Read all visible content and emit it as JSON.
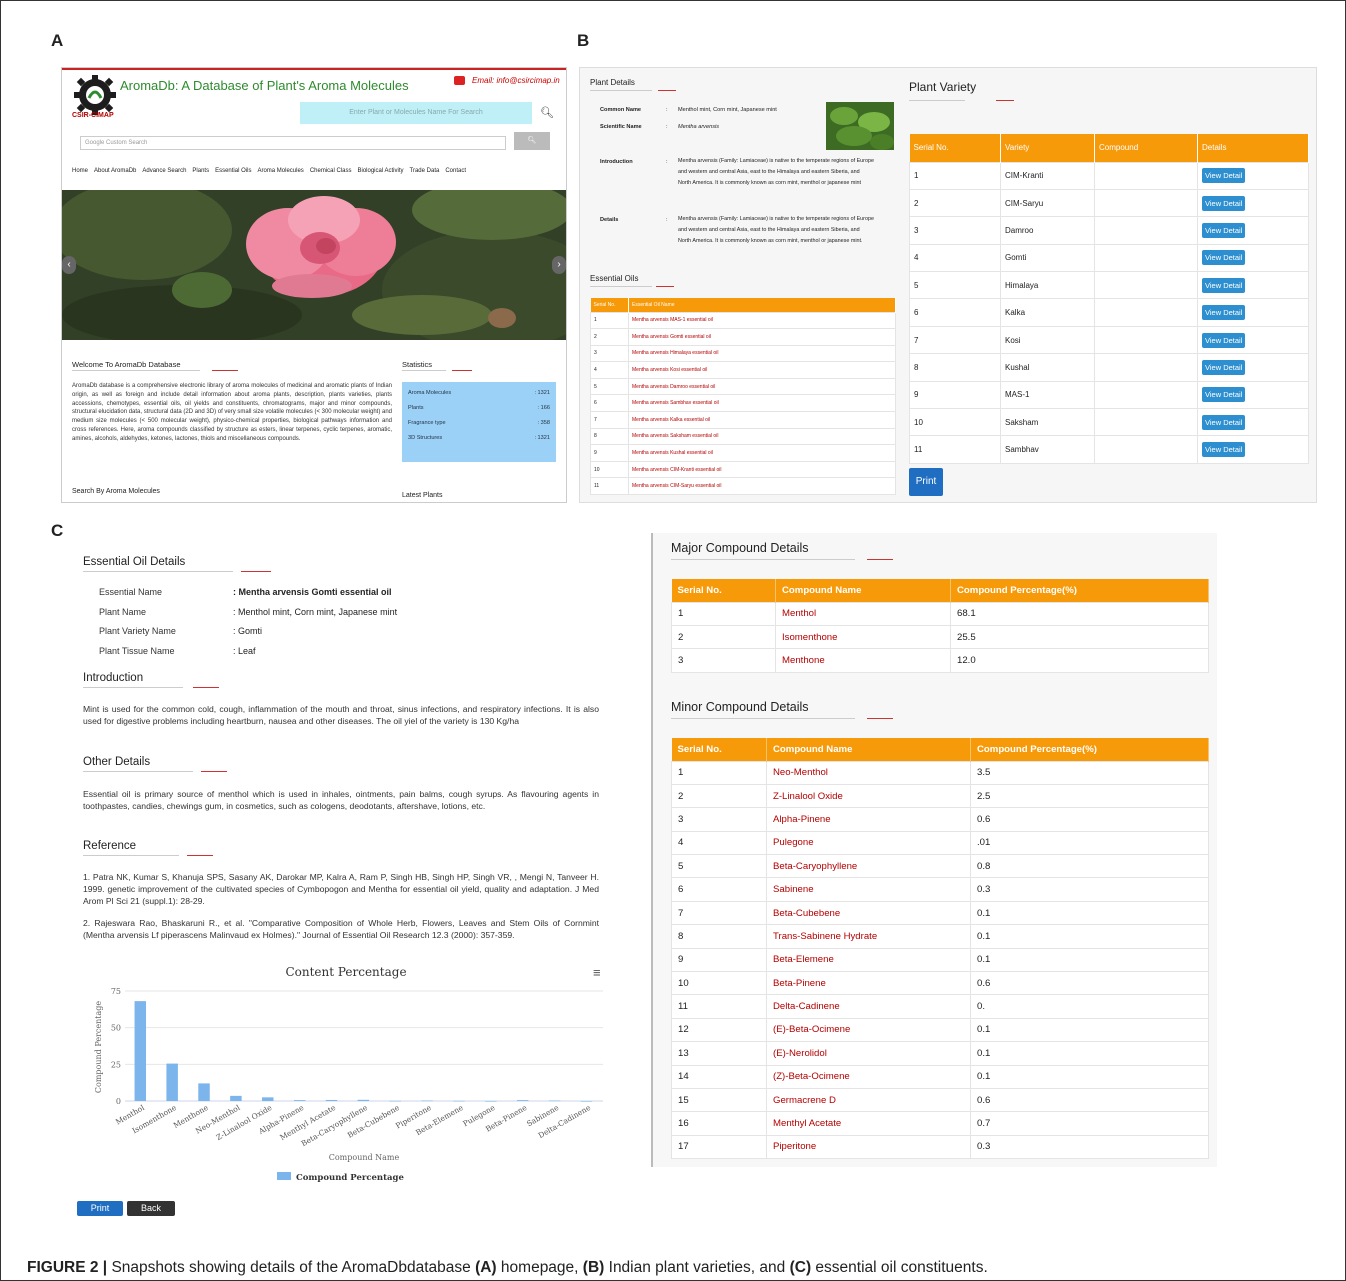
{
  "panel_labels": {
    "a": "A",
    "b": "B",
    "c": "C"
  },
  "homepage": {
    "logo_text": "CSIR-CIMAP",
    "title": "AromaDb: A Database of Plant's Aroma Molecules",
    "email": "Email: info@csircimap.in",
    "search_placeholder": "Enter Plant or Molecules Name For Search",
    "custom_search_placeholder": "Google Custom Search",
    "nav": [
      "Home",
      "About AromaDb",
      "Advance Search",
      "Plants",
      "Essential Oils",
      "Aroma Molecules",
      "Chemical Class",
      "Biological Activity",
      "Trade Data",
      "Contact"
    ],
    "welcome_title": "Welcome To AromaDb Database",
    "welcome_body": "AromaDb database is a comprehensive electronic library of aroma molecules of medicinal and aromatic plants of Indian origin, as well as foreign and include detail information about aroma plants, description, plants varieties, plants accessions, chemotypes, essential oils, oil yields and constituents, chromatograms, major and minor compounds, structural elucidation data, structural data (2D and 3D) of very small size volatile molecules (< 300 molecular weight) and medium size molecules (< 500 molecular weight), physico-chemical properties, biological pathways information and cross references. Here, aroma compounds classified by structure as esters, linear terpenes, cyclic terpenes, aromatic, amines, alcohols, aldehydes, ketones, lactones, thiols and miscellaneous compounds.",
    "statistics_title": "Statistics",
    "stats": [
      {
        "label": "Aroma Molecules",
        "value": ": 1321"
      },
      {
        "label": "Plants",
        "value": ": 166"
      },
      {
        "label": "Fragrance type",
        "value": ": 358"
      },
      {
        "label": "3D Structures",
        "value": ": 1321"
      }
    ],
    "search_by": "Search By Aroma Molecules",
    "latest_plants": "Latest Plants"
  },
  "plant": {
    "details_title": "Plant Details",
    "common_name_label": "Common Name",
    "common_name": "Menthol mint, Corn mint, Japanese mint",
    "scientific_name_label": "Scientific Name",
    "scientific_name": "Mentha arvensis",
    "colon": ":",
    "intro_label": "Introduction",
    "intro": "Mentha arvensis (Family: Lamiaceae) is native to the temperate regions of Europe and western and central Asia, east to the Himalaya and eastern Siberia, and North America. It is commonly known as corn mint, menthol or japanese mint",
    "details_label": "Details",
    "details": "Mentha arvensis (Family: Lamiaceae) is native to the temperate regions of Europe and western and central Asia, east to the Himalaya and eastern Siberia, and North America. It is commonly known as corn mint, menthol or japanese mint.",
    "eo_title": "Essential Oils",
    "eo_headers": [
      "Serial No.",
      "Essential Oil Name"
    ],
    "eo_rows": [
      [
        "1",
        "Mentha arvensis MAS-1 essential oil"
      ],
      [
        "2",
        "Mentha arvensis Gomti essential oil"
      ],
      [
        "3",
        "Mentha arvensis Himalaya essential oil"
      ],
      [
        "4",
        "Mentha arvensis Kosi essential oil"
      ],
      [
        "5",
        "Mentha arvensis Damroo essential oil"
      ],
      [
        "6",
        "Mentha arvensis Sambhav essential oil"
      ],
      [
        "7",
        "Mentha arvensis Kalka essential oil"
      ],
      [
        "8",
        "Mentha arvensis Saksham essential oil"
      ],
      [
        "9",
        "Mentha arvensis Kushal essential oil"
      ],
      [
        "10",
        "Mentha arvensis CIM-Kranti essential oil"
      ],
      [
        "11",
        "Mentha arvensis CIM-Saryu essential oil"
      ]
    ],
    "variety_title": "Plant Variety",
    "variety_headers": [
      "Serial No.",
      "Variety",
      "Compound",
      "Details"
    ],
    "view_detail": "View Detail",
    "varieties": [
      [
        "1",
        "CIM-Kranti",
        ""
      ],
      [
        "2",
        "CIM-Saryu",
        ""
      ],
      [
        "3",
        "Damroo",
        ""
      ],
      [
        "4",
        "Gomti",
        ""
      ],
      [
        "5",
        "Himalaya",
        ""
      ],
      [
        "6",
        "Kalka",
        ""
      ],
      [
        "7",
        "Kosi",
        ""
      ],
      [
        "8",
        "Kushal",
        ""
      ],
      [
        "9",
        "MAS-1",
        ""
      ],
      [
        "10",
        "Saksham",
        ""
      ],
      [
        "11",
        "Sambhav",
        ""
      ]
    ],
    "print": "Print"
  },
  "oil": {
    "title": "Essential Oil Details",
    "fields": [
      {
        "label": "Essential Name",
        "value": ": Mentha arvensis Gomti essential oil"
      },
      {
        "label": "Plant Name",
        "value": ": Menthol mint, Corn mint, Japanese mint"
      },
      {
        "label": "Plant Variety Name",
        "value": ": Gomti"
      },
      {
        "label": "Plant Tissue Name",
        "value": ": Leaf"
      }
    ],
    "intro_title": "Introduction",
    "intro": "Mint is used for the common cold, cough, inflammation of the mouth and throat, sinus infections, and respiratory infections. It is also used for digestive problems including heartburn, nausea and other diseases. The oil yiel of the variety is 130 Kg/ha",
    "other_title": "Other Details",
    "other": "Essential oil is primary source of menthol which is used in inhales, ointments, pain balms, cough syrups. As flavouring agents in toothpastes, candies, chewings gum, in cosmetics, such as cologens, deodotants, aftershave, lotions, etc.",
    "ref_title": "Reference",
    "ref1": "1. Patra NK, Kumar S, Khanuja SPS, Sasany AK, Darokar MP, Kalra A, Ram P, Singh HB, Singh HP, Singh VR, , Mengi N, Tanveer H. 1999. genetic improvement of the cultivated species of Cymbopogon and Mentha for essential oil yield, quality and adaptation. J Med Arom Pl Sci 21 (suppl.1): 28-29.",
    "ref2": "2. Rajeswara Rao, Bhaskaruni R., et al. \"Comparative Composition of Whole Herb, Flowers, Leaves and Stem Oils of Cornmint (Mentha arvensis Lf piperascens Malinvaud ex Holmes).\" Journal of Essential Oil Research 12.3 (2000): 357-359.",
    "print": "Print",
    "back": "Back",
    "major_title": "Major Compound Details",
    "minor_title": "Minor Compound Details",
    "table_headers": [
      "Serial No.",
      "Compound Name",
      "Compound Percentage(%)"
    ],
    "major": [
      [
        "1",
        "Menthol",
        "68.1"
      ],
      [
        "2",
        "Isomenthone",
        "25.5"
      ],
      [
        "3",
        "Menthone",
        "12.0"
      ]
    ],
    "minor": [
      [
        "1",
        "Neo-Menthol",
        "3.5"
      ],
      [
        "2",
        "Z-Linalool Oxide",
        "2.5"
      ],
      [
        "3",
        "Alpha-Pinene",
        "0.6"
      ],
      [
        "4",
        "Pulegone",
        ".01"
      ],
      [
        "5",
        "Beta-Caryophyllene",
        "0.8"
      ],
      [
        "6",
        "Sabinene",
        "0.3"
      ],
      [
        "7",
        "Beta-Cubebene",
        "0.1"
      ],
      [
        "8",
        "Trans-Sabinene Hydrate",
        "0.1"
      ],
      [
        "9",
        "Beta-Elemene",
        "0.1"
      ],
      [
        "10",
        "Beta-Pinene",
        "0.6"
      ],
      [
        "11",
        "Delta-Cadinene",
        "0."
      ],
      [
        "12",
        "(E)-Beta-Ocimene",
        "0.1"
      ],
      [
        "13",
        "(E)-Nerolidol",
        "0.1"
      ],
      [
        "14",
        "(Z)-Beta-Ocimene",
        "0.1"
      ],
      [
        "15",
        "Germacrene D",
        "0.6"
      ],
      [
        "16",
        "Menthyl Acetate",
        "0.7"
      ],
      [
        "17",
        "Piperitone",
        "0.3"
      ]
    ]
  },
  "chart_data": {
    "type": "bar",
    "title": "Content Percentage",
    "xlabel": "Compound Name",
    "ylabel": "Compound Percentage",
    "ylim": [
      0,
      75
    ],
    "yticks": [
      0,
      25,
      50,
      75
    ],
    "legend": "bottom",
    "grid": true,
    "color": "#7cb5ec",
    "categories": [
      "Menthol",
      "Isomenthone",
      "Menthone",
      "Neo-Menthol",
      "Z-Linalool Oxide",
      "Alpha-Pinene",
      "Menthyl Acetate",
      "Beta-Caryophyllene",
      "Beta-Cubebene",
      "Piperitone",
      "Beta-Elemene",
      "Pulegone",
      "Beta-Pinene",
      "Sabinene",
      "Delta-Cadinene"
    ],
    "series": [
      {
        "name": "Compound Percentage",
        "values": [
          68.1,
          25.5,
          12.0,
          3.5,
          2.5,
          0.6,
          0.7,
          0.8,
          0.1,
          0.3,
          0.1,
          0.01,
          0.6,
          0.3,
          0
        ]
      }
    ]
  },
  "caption": {
    "lead": "FIGURE 2 |",
    "p1": " Snapshots showing details of the AromaDbdatabase ",
    "a": "(A)",
    "p2": " homepage, ",
    "b": "(B)",
    "p3": " Indian plant varieties, and ",
    "c": "(C)",
    "p4": " essential oil constituents."
  }
}
